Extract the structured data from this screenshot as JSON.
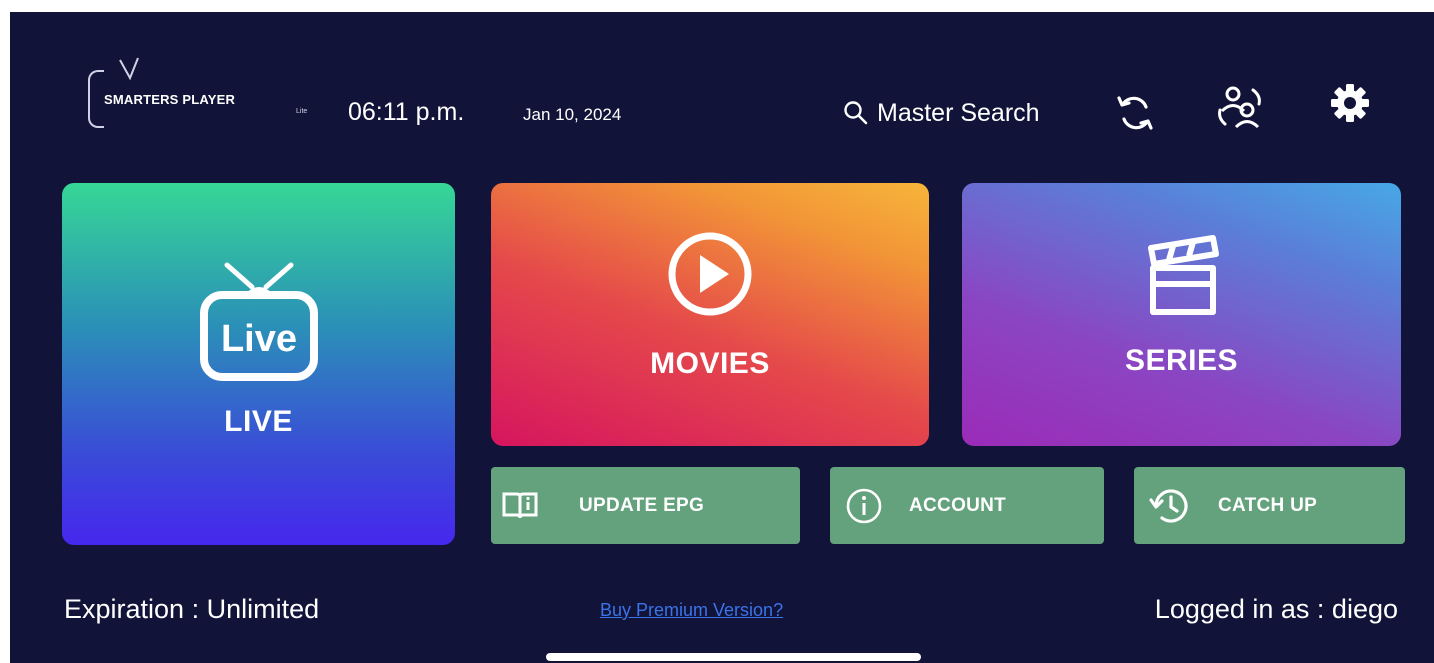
{
  "header": {
    "brand": "SMARTERS PLAYER",
    "brand_sub": "Lite",
    "time": "06:11 p.m.",
    "date": "Jan 10, 2024",
    "search_label": "Master Search",
    "icons": [
      "search-icon",
      "refresh-icon",
      "switch-user-icon",
      "settings-gear-icon"
    ]
  },
  "tiles": {
    "live": {
      "icon_text": "Live",
      "label": "LIVE"
    },
    "movies": {
      "label": "MOVIES"
    },
    "series": {
      "label": "SERIES"
    }
  },
  "actions": {
    "update_epg": "UPDATE EPG",
    "account": "ACCOUNT",
    "catch_up": "CATCH UP"
  },
  "footer": {
    "expiration": "Expiration : Unlimited",
    "premium_link": "Buy Premium Version?",
    "logged_in": "Logged in as : diego"
  },
  "colors": {
    "background": "#121338",
    "action_button": "#64a27d",
    "link": "#3b73e8"
  }
}
